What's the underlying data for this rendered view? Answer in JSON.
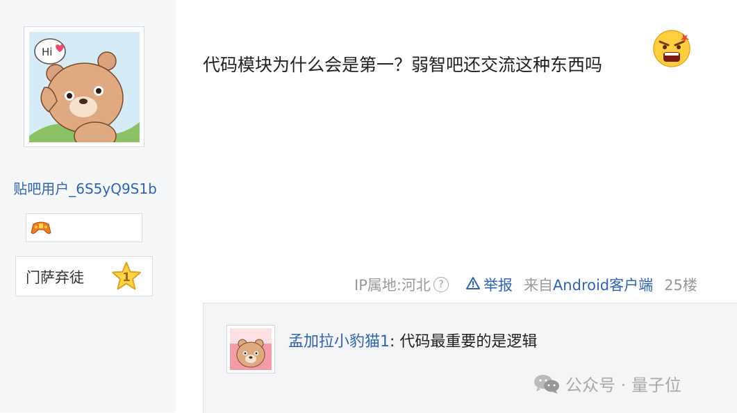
{
  "author": {
    "avatar": "bear-hi-avatar",
    "name": "贴吧用户_6S5yQ9S1b",
    "badge_icon": "gamepad-icon",
    "rank_title": "门萨弃徒",
    "rank_level": "1"
  },
  "post": {
    "text": "代码模块为什么会是第一？弱智吧还交流这种东西吗",
    "emoji": "angry-face-icon"
  },
  "meta": {
    "ip_label": "IP属地:河北",
    "report_label": "举报",
    "from_prefix": "来自",
    "client": "Android客户端",
    "floor": "25楼"
  },
  "reply": {
    "user": "孟加拉小豹猫1",
    "separator": ":",
    "text": " 代码最重要的是逻辑"
  },
  "watermark": {
    "text": "公众号 · 量子位"
  }
}
